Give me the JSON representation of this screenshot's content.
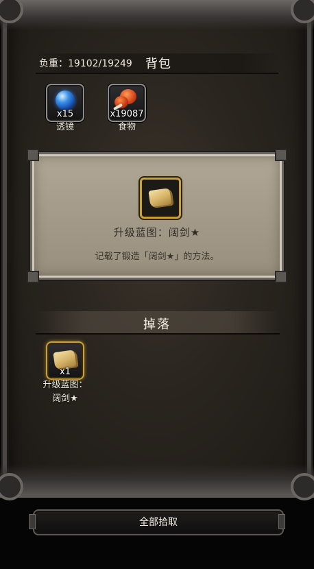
{
  "backpack": {
    "weight_label": "负重：19102/19249",
    "title": "背包",
    "items": [
      {
        "name": "透镜",
        "quantity": "x15",
        "icon": "blue-orb-icon"
      },
      {
        "name": "食物",
        "quantity": "x19087",
        "icon": "meat-icon"
      }
    ]
  },
  "detail": {
    "icon": "scroll-icon",
    "name": "升级蓝图：阔剑★",
    "description": "记载了锻造「阔剑★」的方法。"
  },
  "drops": {
    "title": "掉落",
    "items": [
      {
        "name_line1": "升级蓝图：",
        "name_line2": "阔剑★",
        "quantity": "x1",
        "icon": "scroll-icon"
      }
    ]
  },
  "actions": {
    "collect_all_label": "全部拾取"
  },
  "colors": {
    "gold_border": "#c9a23a",
    "panel_bg": "#a39a89"
  }
}
